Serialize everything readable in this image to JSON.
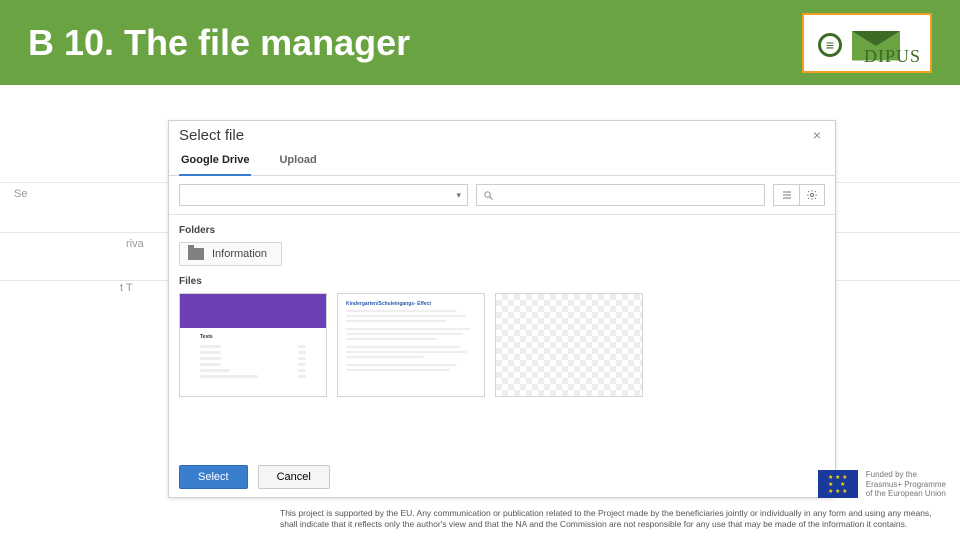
{
  "header": {
    "title": "B 10. The file manager",
    "logo_text": "DIPUS"
  },
  "background": {
    "text_left_1": "Se",
    "text_left_2": "riva",
    "text_left_3": "t T"
  },
  "modal": {
    "title": "Select file",
    "close_label": "×",
    "tabs": [
      {
        "label": "Google Drive",
        "active": true
      },
      {
        "label": "Upload",
        "active": false
      }
    ],
    "toolbar": {
      "dropdown_caret": "▾",
      "search_placeholder": ""
    },
    "sections": {
      "folders_label": "Folders",
      "files_label": "Files"
    },
    "folders": [
      {
        "name": "Information"
      }
    ],
    "files": [
      {
        "kind": "form",
        "title": "Tests"
      },
      {
        "kind": "doc",
        "title": "Kindergarten/Schuleingangs- Effect"
      },
      {
        "kind": "transparent",
        "title": ""
      }
    ],
    "footer": {
      "select": "Select",
      "cancel": "Cancel"
    }
  },
  "eu": {
    "line1": "Funded by the",
    "line2": "Erasmus+ Programme",
    "line3": "of the European Union"
  },
  "disclaimer": "This project is supported by the EU. Any communication or publication related to the Project made by the beneficiaries jointly or individually in any form and using any means, shall indicate that it reflects only the author's view and that the NA and the Commission are not responsible for any use that may be made of the information it contains."
}
